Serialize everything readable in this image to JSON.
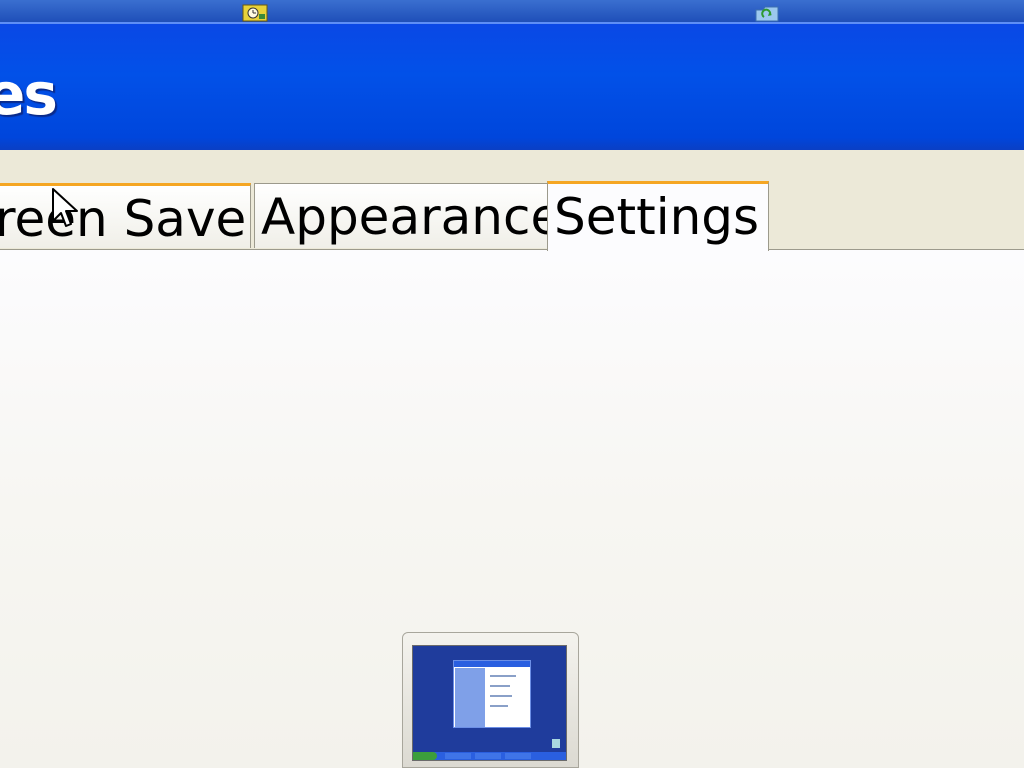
{
  "window": {
    "title_fragment": "es"
  },
  "tray": {
    "icons": [
      "clock-icon",
      "network-folder-icon"
    ]
  },
  "tabs": [
    {
      "label": "reen Saver",
      "state": "inactive"
    },
    {
      "label": "Appearance",
      "state": "inactive"
    },
    {
      "label": "Settings",
      "state": "active"
    }
  ],
  "preview": {
    "icon": "monitor-preview-icon"
  },
  "colors": {
    "titlebar": "#0251E8",
    "tab_accent": "#F5A623",
    "dialog_bg": "#ECE9D8"
  }
}
